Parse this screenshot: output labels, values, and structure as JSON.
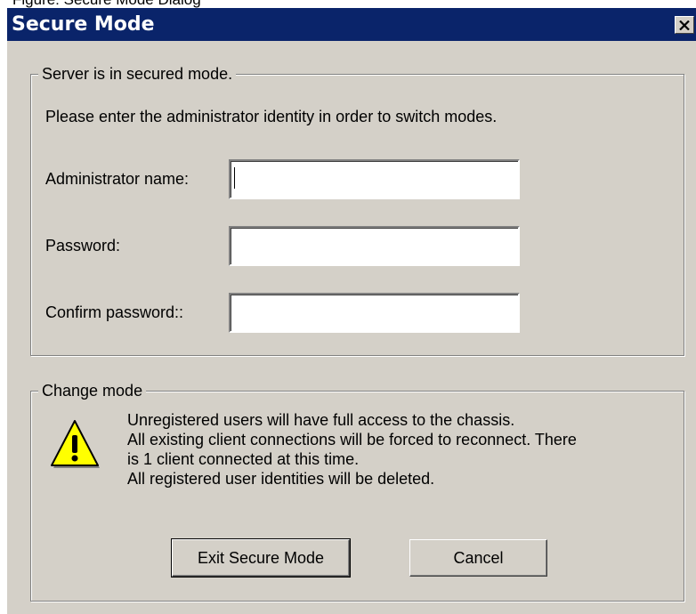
{
  "caption": "Figure: Secure Mode Dialog",
  "window": {
    "title": "Secure Mode",
    "close_glyph": "✕"
  },
  "identity_group": {
    "legend": "Server is in secured mode.",
    "instructions": "Please enter the administrator identity in order to switch modes.",
    "admin_name_label": "Administrator name:",
    "admin_name_value": "",
    "password_label": "Password:",
    "password_value": "",
    "confirm_label": "Confirm password::",
    "confirm_value": ""
  },
  "change_group": {
    "legend": "Change mode",
    "warning_icon": "warning-triangle-icon",
    "warning_lines": [
      "Unregistered users will have full access to the chassis.",
      "All existing client connections will be forced to reconnect. There",
      "is 1 client connected at this time.",
      "All registered user identities will be deleted."
    ]
  },
  "buttons": {
    "exit_secure_mode": "Exit Secure Mode",
    "cancel": "Cancel"
  },
  "colors": {
    "titlebar": "#0a246a",
    "dialog_bg": "#d4d0c8",
    "warning_fill": "#ffff00"
  }
}
